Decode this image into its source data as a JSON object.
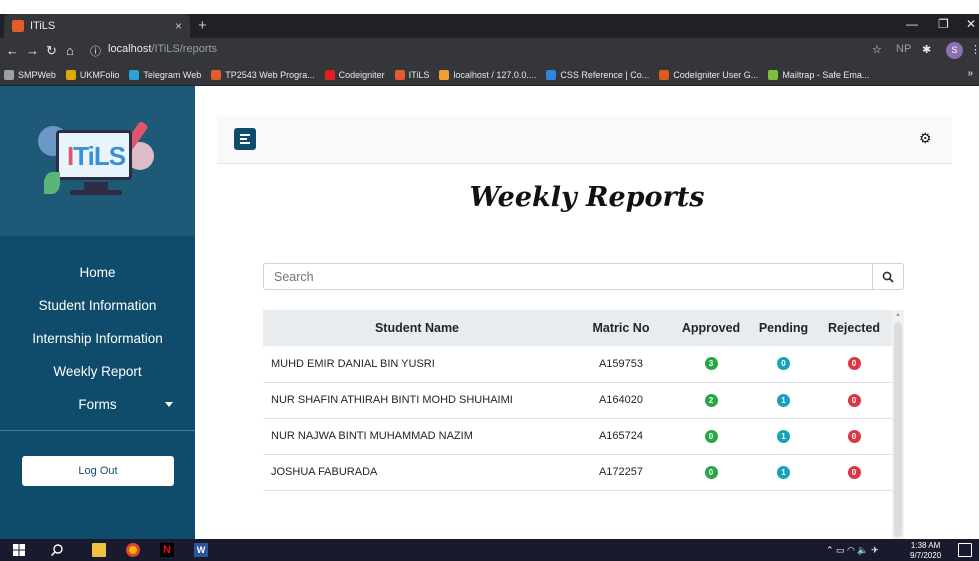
{
  "browser": {
    "tab_title": "ITiLS",
    "tab_close": "×",
    "new_tab": "+",
    "url_host": "localhost",
    "url_path": "/ITiLS/reports",
    "profile_initials": "NP",
    "profile_avatar": "S",
    "bookmarks": [
      {
        "label": "SMPWeb",
        "color": "#9aa0a6"
      },
      {
        "label": "UKMFolio",
        "color": "#e0a800"
      },
      {
        "label": "Telegram Web",
        "color": "#2aa3dd"
      },
      {
        "label": "TP2543 Web Progra...",
        "color": "#e25b2a"
      },
      {
        "label": "Codeigniter",
        "color": "#e02020"
      },
      {
        "label": "ITiLS",
        "color": "#e25b2a"
      },
      {
        "label": "localhost / 127.0.0....",
        "color": "#f0a030"
      },
      {
        "label": "CSS Reference | Co...",
        "color": "#2e86de"
      },
      {
        "label": "CodeIgniter User G...",
        "color": "#e05a1f"
      },
      {
        "label": "Mailtrap - Safe Ema...",
        "color": "#7fbf3f"
      }
    ],
    "bookmarks_more": "»"
  },
  "sidebar": {
    "logo_text_a": "I",
    "logo_text_b": "TiLS",
    "items": [
      {
        "label": "Home"
      },
      {
        "label": "Student Information"
      },
      {
        "label": "Internship Information"
      },
      {
        "label": "Weekly Report"
      },
      {
        "label": "Forms"
      }
    ],
    "logout_label": "Log Out"
  },
  "main": {
    "title": "Weekly Reports",
    "search_placeholder": "Search",
    "table": {
      "headers": [
        "Student Name",
        "Matric No",
        "Approved",
        "Pending",
        "Rejected"
      ],
      "rows": [
        {
          "name": "MUHD EMIR DANIAL BIN YUSRI",
          "matric": "A159753",
          "approved": "3",
          "pending": "0",
          "rejected": "0"
        },
        {
          "name": "NUR SHAFIN ATHIRAH BINTI MOHD SHUHAIMI",
          "matric": "A164020",
          "approved": "2",
          "pending": "1",
          "rejected": "0"
        },
        {
          "name": "NUR NAJWA BINTI MUHAMMAD NAZIM",
          "matric": "A165724",
          "approved": "0",
          "pending": "1",
          "rejected": "0"
        },
        {
          "name": "JOSHUA FABURADA",
          "matric": "A172257",
          "approved": "0",
          "pending": "1",
          "rejected": "0"
        }
      ]
    },
    "colors": {
      "approved": "#28a745",
      "pending": "#17a2b8",
      "rejected": "#dc3545",
      "sidebar": "#0f4c6b"
    }
  },
  "taskbar": {
    "time": "1:38 AM",
    "date": "9/7/2020"
  }
}
